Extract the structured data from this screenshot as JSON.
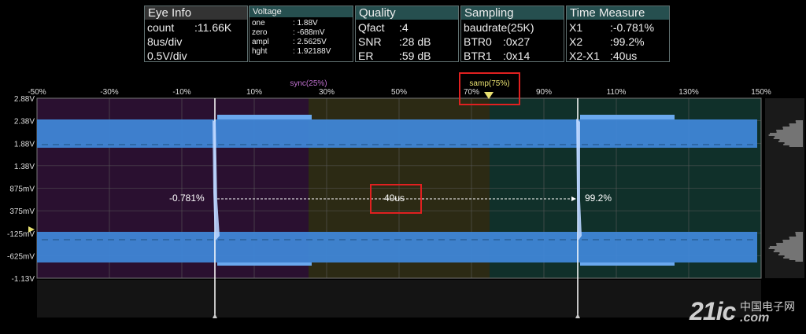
{
  "panels": {
    "eye_info": {
      "title": "Eye Info",
      "rows": [
        {
          "k": "count",
          "v": ":11.66K"
        },
        {
          "k": "8us/div",
          "v": ""
        },
        {
          "k": "0.5V/div",
          "v": ""
        }
      ]
    },
    "voltage": {
      "title": "Voltage",
      "rows": [
        {
          "k": "one",
          "v": ": 1.88V"
        },
        {
          "k": "zero",
          "v": ": -688mV"
        },
        {
          "k": "ampl",
          "v": ": 2.5625V"
        },
        {
          "k": "hght",
          "v": ": 1.92188V"
        }
      ]
    },
    "quality": {
      "title": "Quality",
      "rows": [
        {
          "k": "Qfact",
          "v": ":4"
        },
        {
          "k": "SNR",
          "v": ":28 dB"
        },
        {
          "k": "ER",
          "v": ":59 dB"
        }
      ]
    },
    "sampling": {
      "title": "Sampling",
      "rows": [
        {
          "k": "baudrate(25K)",
          "v": ""
        },
        {
          "k": "BTR0",
          "v": ":0x27"
        },
        {
          "k": "BTR1",
          "v": ":0x14"
        }
      ]
    },
    "time_measure": {
      "title": "Time Measure",
      "rows": [
        {
          "k": "X1",
          "v": ":-0.781%"
        },
        {
          "k": "X2",
          "v": ":99.2%"
        },
        {
          "k": "X2-X1",
          "v": ":40us"
        }
      ]
    }
  },
  "plot": {
    "x_ticks": [
      "-50%",
      "-30%",
      "-10%",
      "10%",
      "30%",
      "50%",
      "70%",
      "90%",
      "110%",
      "130%",
      "150%"
    ],
    "y_ticks": [
      "2.88V",
      "2.38V",
      "1.88V",
      "1.38V",
      "875mV",
      "375mV",
      "-125mV",
      "-625mV",
      "-1.13V"
    ],
    "sync_label": "sync(25%)",
    "samp_label": "samp(75%)",
    "cursor_x1_label": "-0.781%",
    "cursor_x2_label": "99.2%",
    "delta_label": "40us",
    "colors": {
      "sync_region": "#2a1030",
      "mid_region": "#2c2a14",
      "samp_region": "#10302a",
      "trace": "#3f86d6",
      "sync_text": "#c070d0",
      "samp_text": "#e8e070",
      "grid": "#5a5a5a",
      "callout": "#e02020"
    }
  },
  "watermark": {
    "main": "21ic",
    "cn": "中国电子网",
    "com": ".com"
  }
}
